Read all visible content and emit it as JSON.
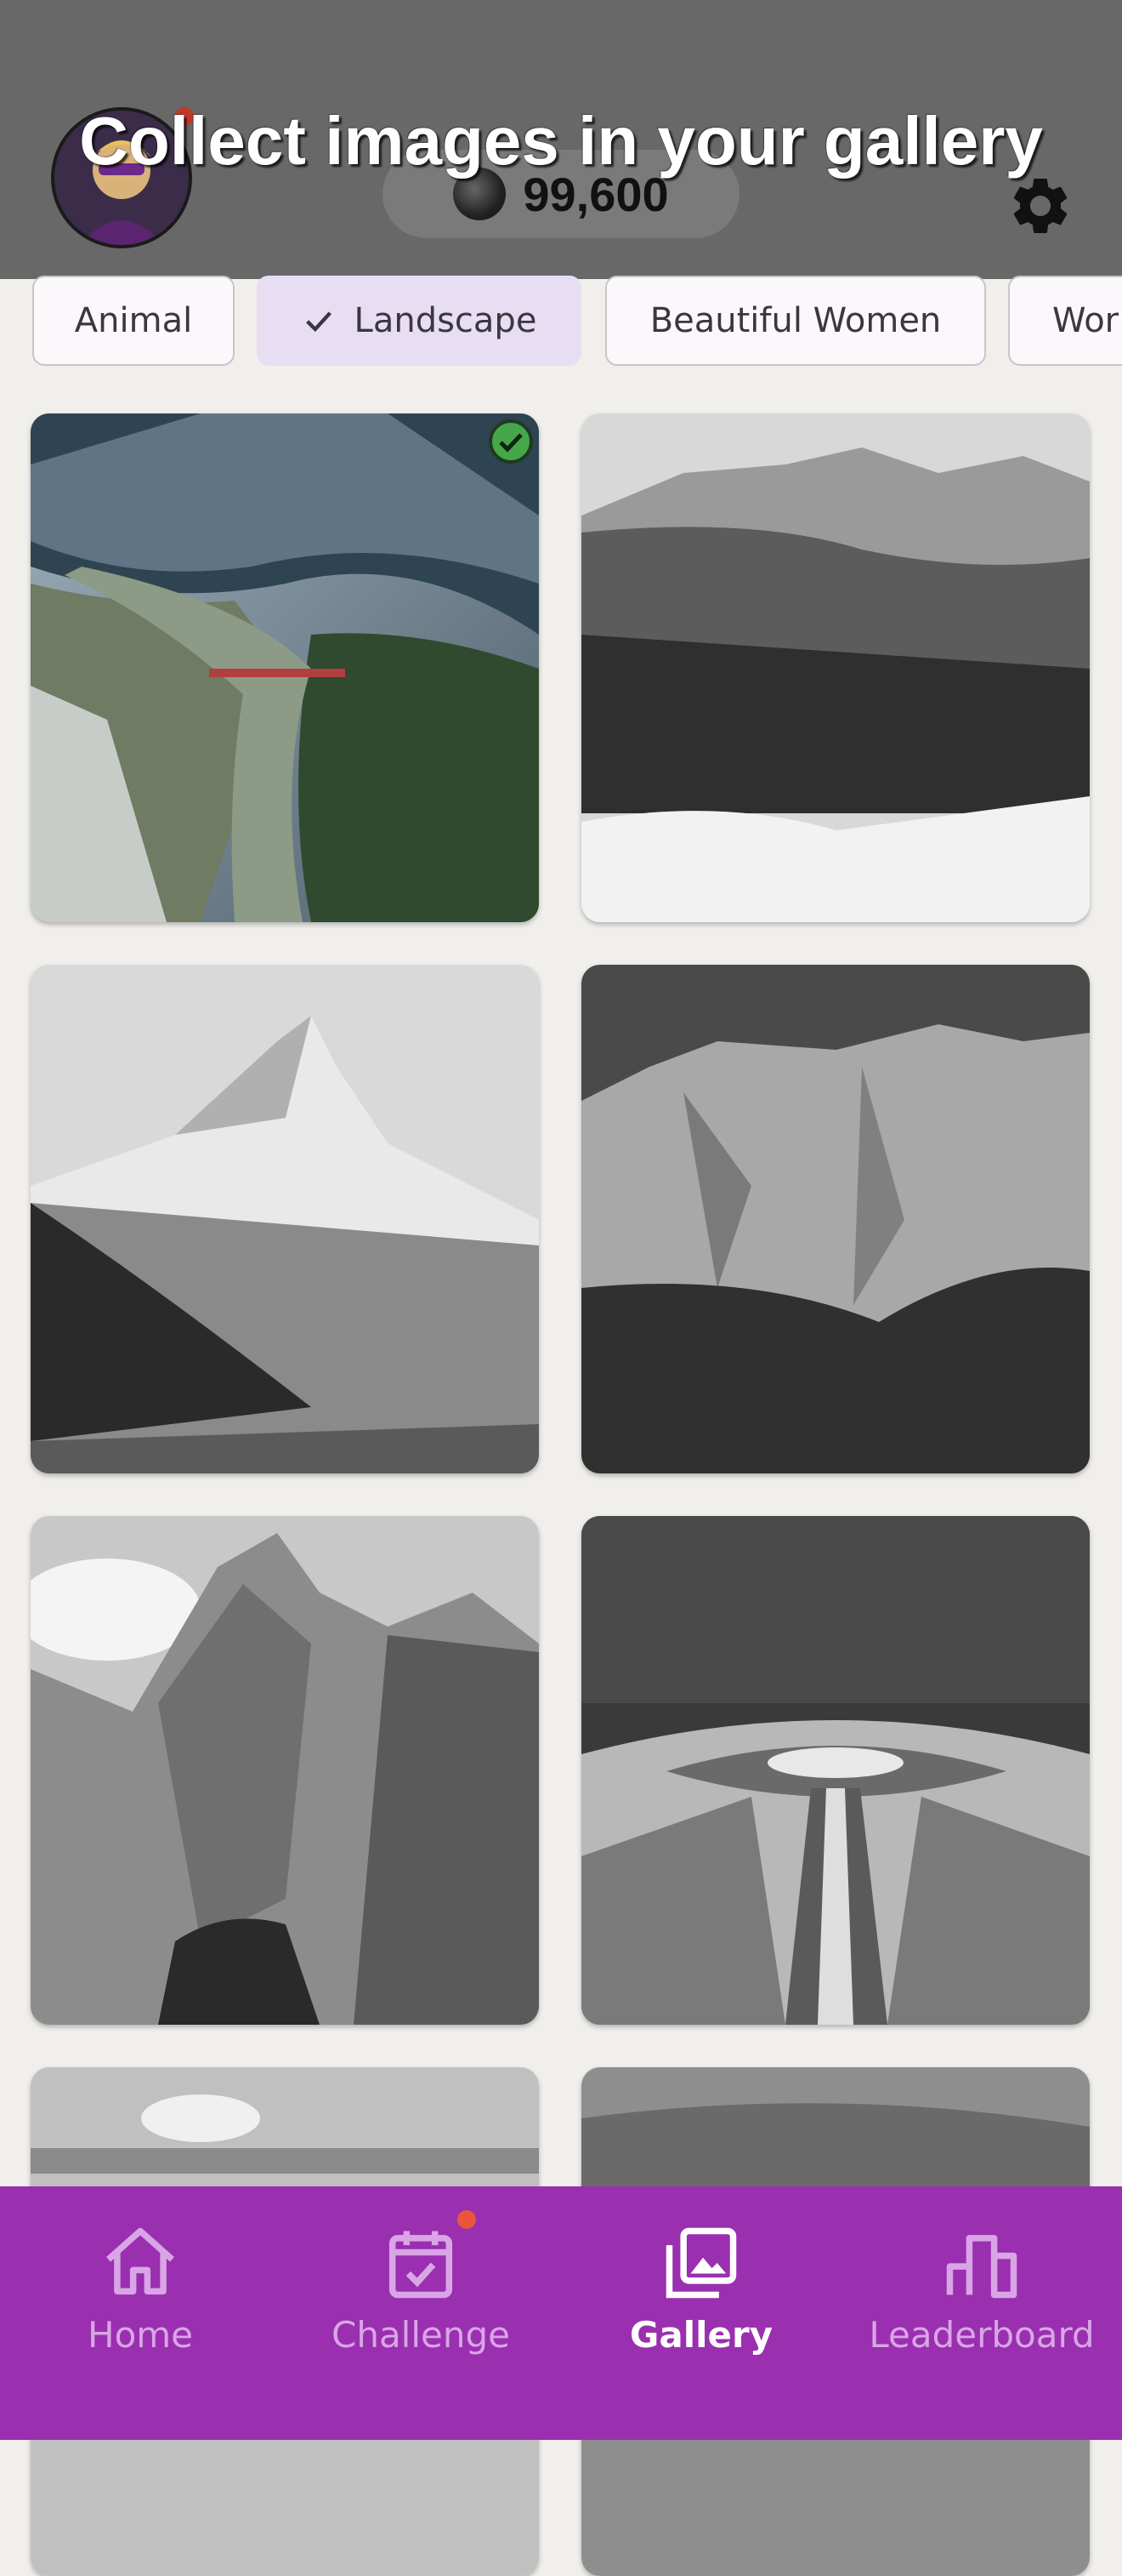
{
  "header": {
    "title": "Collect images in your gallery",
    "coins": "99,600",
    "avatar_icon": "avatar-character",
    "settings_icon": "gear-icon",
    "colors": {
      "overlay": "#686868",
      "title": "#ffffff"
    }
  },
  "categories": [
    {
      "label": "Animal",
      "selected": false
    },
    {
      "label": "Landscape",
      "selected": true
    },
    {
      "label": "Beautiful Women",
      "selected": false
    },
    {
      "label": "Wor",
      "selected": false
    }
  ],
  "gallery": {
    "images": [
      {
        "name": "river-valley-aerial",
        "collected": true,
        "color": true
      },
      {
        "name": "snowy-mountain-forest",
        "collected": false,
        "color": false
      },
      {
        "name": "matterhorn-peak",
        "collected": false,
        "color": false
      },
      {
        "name": "rocky-cliff-wall",
        "collected": false,
        "color": false
      },
      {
        "name": "jagged-mountain-valley",
        "collected": false,
        "color": false
      },
      {
        "name": "formal-garden-path",
        "collected": false,
        "color": false
      },
      {
        "name": "cloudy-sky",
        "collected": false,
        "color": false
      },
      {
        "name": "overcast-sky",
        "collected": false,
        "color": false
      }
    ]
  },
  "nav": {
    "items": [
      {
        "label": "Home",
        "icon": "home-icon",
        "active": false
      },
      {
        "label": "Challenge",
        "icon": "calendar-check-icon",
        "active": false,
        "notification": true
      },
      {
        "label": "Gallery",
        "icon": "gallery-icon",
        "active": true
      },
      {
        "label": "Leaderboard",
        "icon": "leaderboard-icon",
        "active": false
      }
    ],
    "colors": {
      "background": "#9a2fb0",
      "active": "#ffffff",
      "inactive": "#d9a5e6"
    }
  }
}
